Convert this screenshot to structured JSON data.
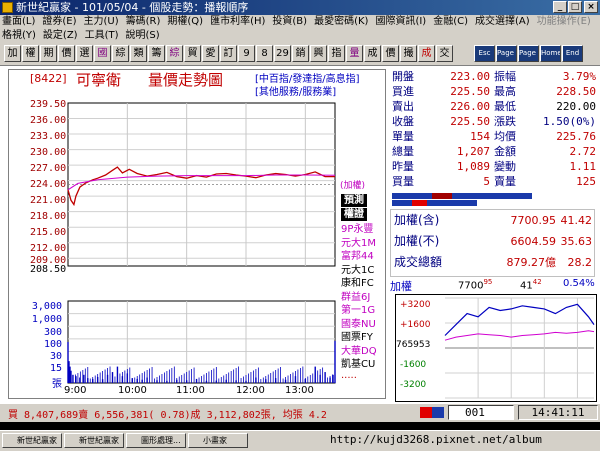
{
  "window": {
    "title": "新世紀贏家 - 101/05/04 - 個股走勢：播報順序",
    "buttons": [
      "_",
      "□",
      "×"
    ]
  },
  "menu": {
    "row1": [
      "畫面(L)",
      "證券(E)",
      "主力(U)",
      "籌碼(R)",
      "期權(Q)",
      "匯市利率(H)",
      "投資(B)",
      "最愛密碼(K)",
      "國際資訊(I)",
      "金融(C)",
      "成交選擇(A)",
      "功能操作(E)"
    ],
    "row2": [
      "格視(Y)",
      "設定(Z)",
      "工具(T)",
      "說明(S)"
    ]
  },
  "toolbar": {
    "buttons": [
      {
        "label": "加",
        "color": "#000000"
      },
      {
        "label": "權",
        "color": "#000000"
      },
      {
        "label": "期",
        "color": "#000000"
      },
      {
        "label": "價",
        "color": "#000000"
      },
      {
        "label": "選",
        "color": "#000000"
      },
      {
        "label": "國",
        "color": "#800080"
      },
      {
        "label": "綜",
        "color": "#000000"
      },
      {
        "label": "類",
        "color": "#000000"
      },
      {
        "label": "籌",
        "color": "#000000"
      },
      {
        "label": "綜",
        "color": "#800080"
      },
      {
        "label": "貿",
        "color": "#000000"
      },
      {
        "label": "愛",
        "color": "#000000"
      },
      {
        "label": "訂",
        "color": "#000000"
      },
      {
        "label": "9",
        "color": "#000000"
      },
      {
        "label": "8",
        "color": "#000000"
      },
      {
        "label": "29",
        "color": "#000000"
      },
      {
        "label": "銷",
        "color": "#000000"
      },
      {
        "label": "興",
        "color": "#000000"
      },
      {
        "label": "指",
        "color": "#000000"
      },
      {
        "label": "量",
        "color": "#800080"
      },
      {
        "label": "成",
        "color": "#000000"
      },
      {
        "label": "價",
        "color": "#000000"
      },
      {
        "label": "撮",
        "color": "#000000"
      },
      {
        "label": "成",
        "color": "#c00000"
      },
      {
        "label": "交",
        "color": "#000000"
      }
    ],
    "wide_buttons": [
      "Esc",
      "Page Up",
      "Page Dn",
      "Home",
      "End"
    ]
  },
  "chart_header": {
    "code": "[8422]",
    "name": "可寧衛",
    "title": "量價走勢圖",
    "links1": "[中百指/發達指/高息指]",
    "links2": "[其他服務/服務業]"
  },
  "price_axis_labels": [
    "239.50",
    "236.00",
    "233.00",
    "230.00",
    "227.00",
    "224.00",
    "221.00",
    "218.00",
    "215.00",
    "212.00",
    "209.00"
  ],
  "prev_close_label": "208.50",
  "volume_axis_labels": [
    "3,000",
    "1,000",
    "300",
    "100",
    "30",
    "15",
    "張"
  ],
  "time_labels": [
    "9:00",
    "10:00",
    "11:00",
    "12:00",
    "13:00"
  ],
  "plus_weight_label": "(加權)",
  "broker_panel": {
    "header1": "預測",
    "header2": "權證",
    "items": [
      {
        "name": "9P永豐",
        "color": "#c000c0"
      },
      {
        "name": "元大1M",
        "color": "#c000c0"
      },
      {
        "name": "富邦44",
        "color": "#c000c0"
      },
      {
        "name": "元大1C",
        "color": "#000000"
      },
      {
        "name": "康和FC",
        "color": "#000000"
      },
      {
        "name": "群益6J",
        "color": "#c000c0"
      },
      {
        "name": "第一1G",
        "color": "#c000c0"
      },
      {
        "name": "國泰NU",
        "color": "#c000c0"
      },
      {
        "name": "國票FY",
        "color": "#000000"
      },
      {
        "name": "大華DQ",
        "color": "#c000c0"
      },
      {
        "name": "凱基CU",
        "color": "#000000"
      },
      {
        "name": "·····",
        "color": "#c00000"
      }
    ]
  },
  "quote": {
    "rows": [
      {
        "l1": "開盤",
        "v1": "223.00",
        "l2": "振幅",
        "v2": "3.79%",
        "c2": "#c00000"
      },
      {
        "l1": "買進",
        "v1": "225.50",
        "l2": "最高",
        "v2": "228.50",
        "c2": "#c00000"
      },
      {
        "l1": "賣出",
        "v1": "226.00",
        "l2": "最低",
        "v2": "220.00",
        "c2": "#000000"
      },
      {
        "l1": "收盤",
        "v1": "225.50",
        "l2": "漲跌",
        "v2": "1.50(0%)",
        "c2": "#000080"
      },
      {
        "l1": "單量",
        "v1": "154",
        "l2": "均價",
        "v2": "225.76",
        "c2": "#c00000"
      },
      {
        "l1": "總量",
        "v1": "1,207",
        "l2": "金額",
        "v2": "2.72",
        "c2": "#c00000"
      },
      {
        "l1": "昨量",
        "v1": "1,089",
        "l2": "變動",
        "v2": "1.11",
        "c2": "#c00000"
      },
      {
        "l1": "買量",
        "v1": "5",
        "l2": "賣量",
        "v2": "125",
        "c2": "#c00000"
      }
    ]
  },
  "index_box": {
    "rows": [
      {
        "label": "加權(含)",
        "value": "7700.95",
        "change": "41.42"
      },
      {
        "label": "加權(不)",
        "value": "6604.59",
        "change": "35.63"
      },
      {
        "label": "成交總額",
        "value": "879.27億",
        "change": "28.2"
      }
    ]
  },
  "mini_chart": {
    "title": "加權",
    "value_main": "7700",
    "value_sup": "95",
    "change_main": "41",
    "change_sup": "42",
    "percent": "0.54%",
    "axis": [
      "+3200",
      "+1600",
      "765953",
      "-1600",
      "-3200"
    ]
  },
  "status": {
    "text": "買 8,407,689賣 6,556,381( 0.78)成 3,112,802張, 均張 4.2",
    "input": "001",
    "time": "14:41:11",
    "watermark": "http://kujd3268.pixnet.net/album"
  },
  "taskbar": {
    "items": [
      "新世紀贏家",
      "新世紀贏家",
      "圖形處理...",
      "小畫家"
    ]
  },
  "chart_data": {
    "type": "line",
    "x_range": [
      "9:00",
      "13:30"
    ],
    "ylim": [
      208.5,
      239.5
    ],
    "series": [
      {
        "x": [
          0,
          3,
          6,
          8,
          12,
          18,
          25,
          30,
          38,
          45,
          50,
          55,
          62,
          70,
          80,
          90,
          100,
          110,
          120,
          130,
          140,
          150,
          160,
          170,
          180,
          190,
          200,
          210,
          220,
          230,
          240,
          250,
          260,
          270
        ],
        "values": [
          223.0,
          221.0,
          220.2,
          221.8,
          223.5,
          224.3,
          224.9,
          225.2,
          225.8,
          226.7,
          227.3,
          226.2,
          226.9,
          226.1,
          225.6,
          225.9,
          226.3,
          225.5,
          225.2,
          225.7,
          225.4,
          226.0,
          226.1,
          225.8,
          225.6,
          225.3,
          225.8,
          226.1,
          225.9,
          225.6,
          225.9,
          226.4,
          225.5,
          225.5
        ]
      },
      {
        "x": [
          0,
          10,
          30,
          60,
          90,
          120,
          150,
          180,
          210,
          240,
          270
        ],
        "values": [
          223.0,
          224.2,
          224.9,
          225.4,
          225.6,
          225.7,
          225.7,
          225.7,
          225.8,
          225.8,
          225.76
        ]
      }
    ],
    "volume": {
      "ylim": [
        0,
        300
      ],
      "x": [
        0,
        1,
        2,
        3,
        5,
        8,
        12,
        16,
        20,
        25,
        30,
        35,
        40,
        45,
        50,
        55,
        60,
        65,
        70,
        75,
        80,
        90,
        100,
        110,
        120,
        130,
        140,
        150,
        160,
        170,
        180,
        190,
        200,
        210,
        220,
        230,
        240,
        250,
        255,
        260,
        265,
        268,
        270
      ],
      "values": [
        150,
        80,
        60,
        45,
        30,
        25,
        20,
        30,
        18,
        15,
        22,
        14,
        30,
        40,
        60,
        25,
        35,
        18,
        15,
        12,
        20,
        10,
        8,
        12,
        10,
        15,
        8,
        9,
        12,
        10,
        8,
        20,
        14,
        18,
        12,
        25,
        15,
        60,
        30,
        40,
        20,
        30,
        154
      ]
    },
    "mini": {
      "ylim": [
        -3200,
        3200
      ],
      "x": [
        0,
        20,
        40,
        60,
        80,
        100,
        120,
        140,
        160,
        180,
        200,
        220,
        240,
        260,
        270
      ],
      "values": [
        800,
        1500,
        2200,
        2000,
        2600,
        2400,
        2500,
        2700,
        2600,
        2500,
        2200,
        2600,
        2800,
        2000,
        1500
      ],
      "ref_values": [
        500,
        700,
        800,
        900,
        850,
        800,
        700,
        800,
        850,
        900,
        1000,
        950,
        1000,
        1100,
        1050
      ]
    }
  }
}
